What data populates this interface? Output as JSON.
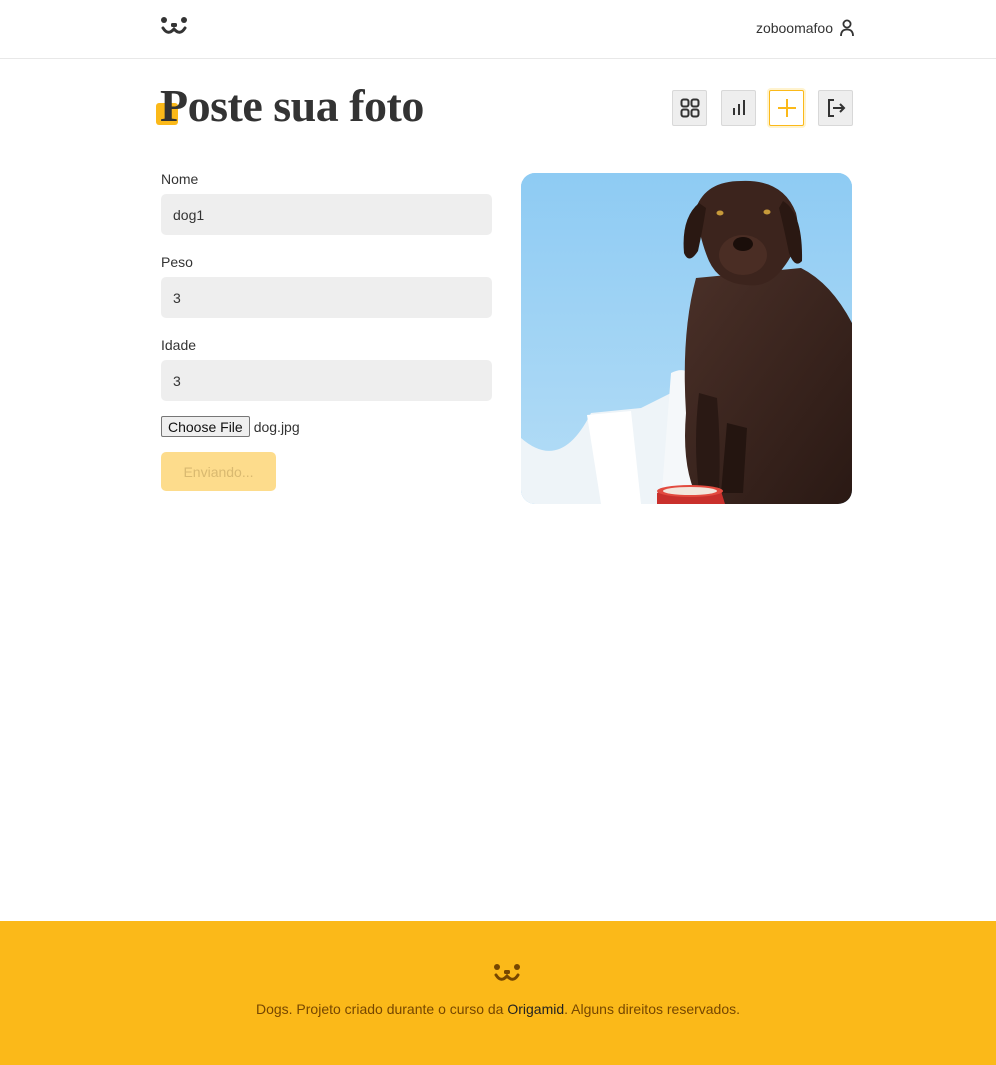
{
  "header": {
    "logo_icon": "dog-face-icon",
    "username": "zoboomafoo",
    "user_icon": "user-icon"
  },
  "page": {
    "title": "Poste sua foto"
  },
  "nav": {
    "items": [
      {
        "icon": "grid-feed-icon",
        "active": false
      },
      {
        "icon": "stats-bars-icon",
        "active": false
      },
      {
        "icon": "plus-icon",
        "active": true
      },
      {
        "icon": "logout-icon",
        "active": false
      }
    ]
  },
  "form": {
    "nome_label": "Nome",
    "nome_value": "dog1",
    "peso_label": "Peso",
    "peso_value": "3",
    "idade_label": "Idade",
    "idade_value": "3",
    "file_button": "Choose File",
    "file_name": "dog.jpg",
    "submit_label": "Enviando..."
  },
  "footer": {
    "logo_icon": "dog-face-icon",
    "text_before": "Dogs. Projeto criado durante o curso da ",
    "link": "Origamid",
    "text_after": ". Alguns direitos reservados."
  },
  "colors": {
    "accent": "#fbb919",
    "input_bg": "#eeeeee",
    "disabled_button": "#fddc8c",
    "text": "#333333"
  }
}
